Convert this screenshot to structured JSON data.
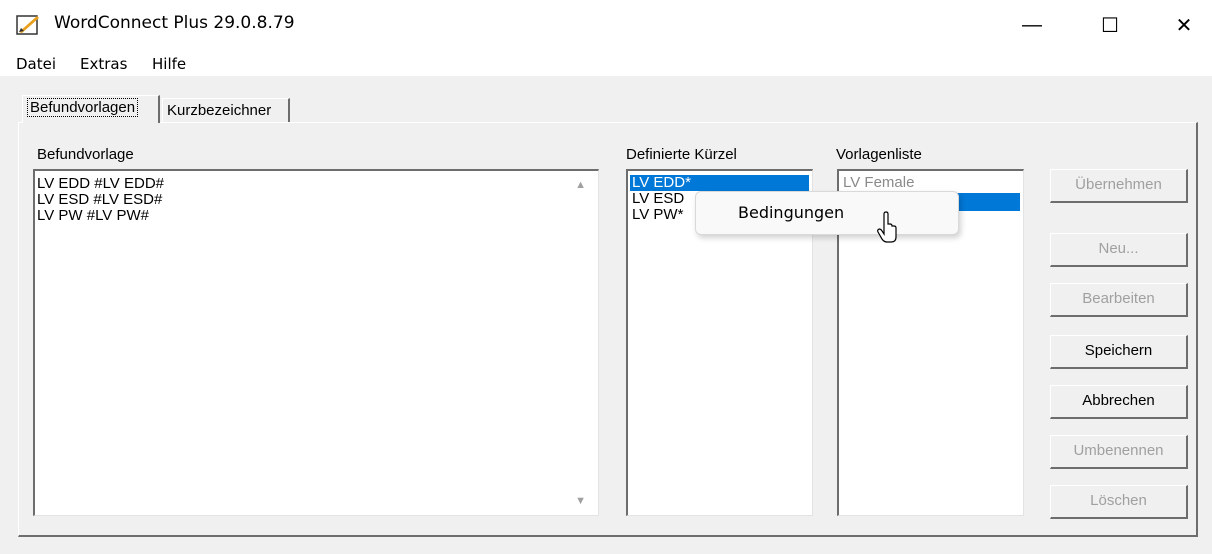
{
  "window": {
    "title": "WordConnect Plus 29.0.8.79",
    "minimize_glyph": "—",
    "maximize_glyph": "☐",
    "close_glyph": "✕"
  },
  "menu": [
    "Datei",
    "Extras",
    "Hilfe"
  ],
  "tabs": [
    {
      "label": "Befundvorlagen",
      "active": true
    },
    {
      "label": "Kurzbezeichner",
      "active": false
    }
  ],
  "befundvorlage": {
    "label": "Befundvorlage",
    "lines": [
      "LV EDD #LV EDD#",
      "LV ESD #LV ESD#",
      "LV PW #LV PW#"
    ]
  },
  "kuerzel": {
    "label": "Definierte Kürzel",
    "items": [
      "LV EDD*",
      "LV ESD",
      "LV PW*"
    ],
    "selected_index": 0
  },
  "vorlagenliste": {
    "label": "Vorlagenliste",
    "items": [
      "LV Female",
      ""
    ],
    "selected_index": 1
  },
  "buttons": [
    {
      "label": "Übernehmen",
      "enabled": false
    },
    {
      "label": "Neu...",
      "enabled": false
    },
    {
      "label": "Bearbeiten",
      "enabled": false
    },
    {
      "label": "Speichern",
      "enabled": true
    },
    {
      "label": "Abbrechen",
      "enabled": true
    },
    {
      "label": "Umbenennen",
      "enabled": false
    },
    {
      "label": "Löschen",
      "enabled": false
    }
  ],
  "context_menu": {
    "items": [
      "Bedingungen"
    ]
  },
  "icons": {
    "app": "wordconnect-app-icon",
    "scroll_up": "scroll-up-arrow-icon",
    "scroll_down": "scroll-down-arrow-icon",
    "cursor": "mouse-pointer-icon"
  },
  "colors": {
    "selection": "#0078d7",
    "window_bg": "#f0f0f0",
    "disabled_text": "#a0a0a0"
  }
}
